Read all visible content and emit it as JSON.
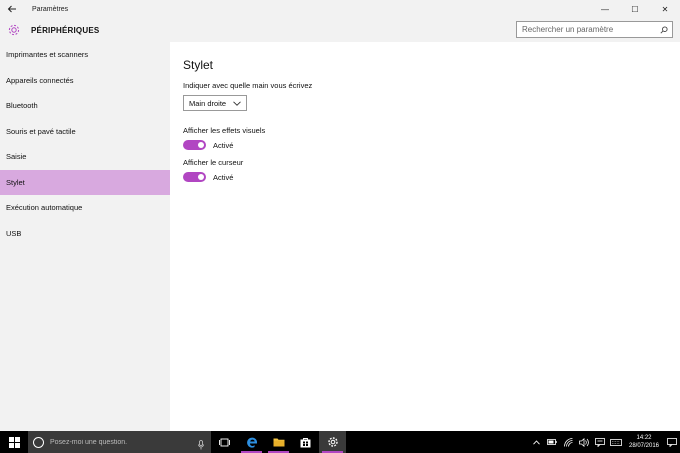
{
  "window": {
    "title": "Paramètres",
    "controls": {
      "minimize": "—",
      "maximize": "☐",
      "close": "✕"
    }
  },
  "header": {
    "section_title": "PÉRIPHÉRIQUES",
    "search_placeholder": "Rechercher un paramètre"
  },
  "sidebar": {
    "items": [
      {
        "label": "Imprimantes et scanners"
      },
      {
        "label": "Appareils connectés"
      },
      {
        "label": "Bluetooth"
      },
      {
        "label": "Souris et pavé tactile"
      },
      {
        "label": "Saisie"
      },
      {
        "label": "Stylet",
        "selected": true
      },
      {
        "label": "Exécution automatique"
      },
      {
        "label": "USB"
      }
    ]
  },
  "main": {
    "title": "Stylet",
    "hand_label": "Indiquer avec quelle main vous écrivez",
    "hand_value": "Main droite",
    "visual_effects_label": "Afficher les effets visuels",
    "visual_effects_state": "Activé",
    "visual_effects_on": true,
    "cursor_label": "Afficher le curseur",
    "cursor_state": "Activé",
    "cursor_on": true
  },
  "taskbar": {
    "cortana_placeholder": "Posez-moi une question.",
    "clock_time": "14:22",
    "clock_date": "28/07/2016"
  },
  "colors": {
    "accent": "#b146c2",
    "selection": "#d8a9df"
  }
}
